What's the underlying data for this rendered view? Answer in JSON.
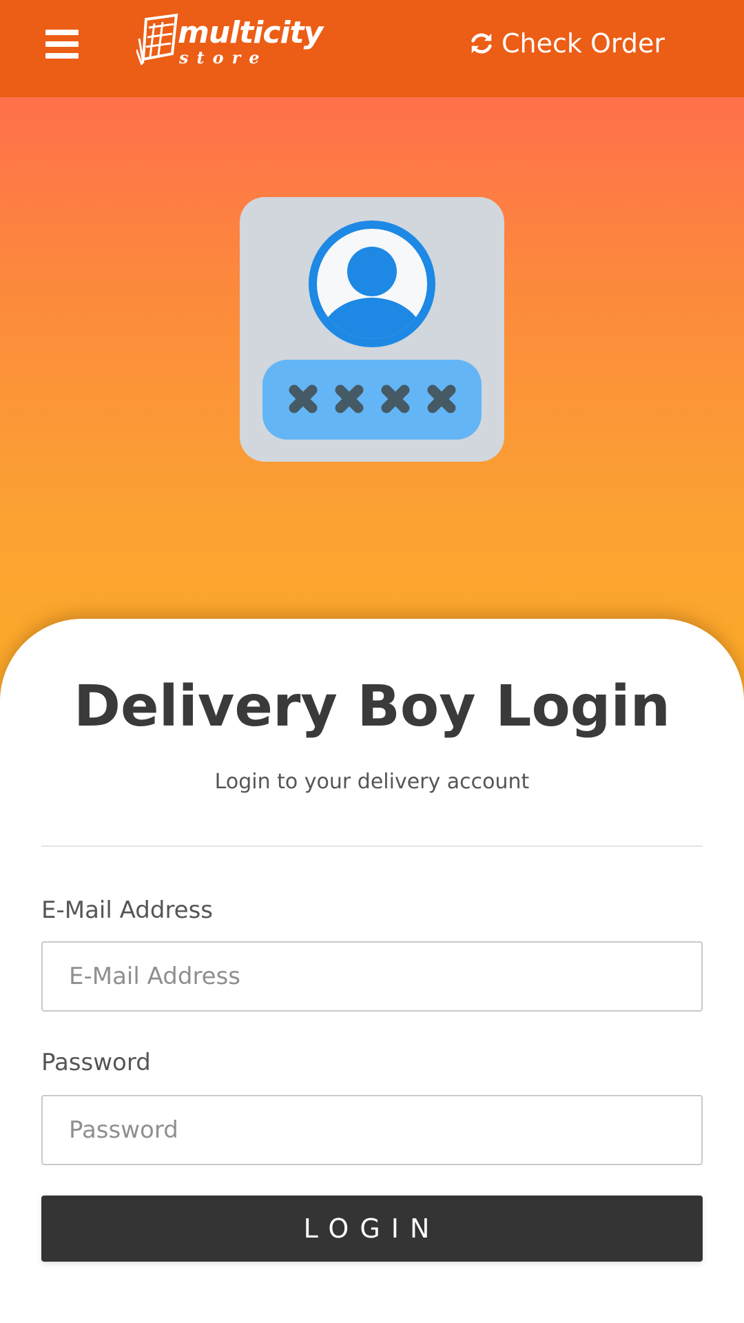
{
  "header": {
    "menu_icon": "hamburger-menu-icon",
    "logo": {
      "word": "multicity",
      "sub": "store"
    },
    "check_order": {
      "icon": "refresh-icon",
      "label": "Check Order"
    },
    "color": "#ec5d15"
  },
  "hero": {
    "icon": "user-password-login-icon",
    "gradient": [
      "#ff704b",
      "#fbac25"
    ]
  },
  "login": {
    "title": "Delivery Boy Login",
    "subtitle": "Login to your delivery account",
    "email": {
      "label": "E-Mail Address",
      "placeholder": "E-Mail Address",
      "value": ""
    },
    "password": {
      "label": "Password",
      "placeholder": "Password",
      "value": ""
    },
    "submit_label": "LOGIN",
    "button_color": "#343434"
  }
}
